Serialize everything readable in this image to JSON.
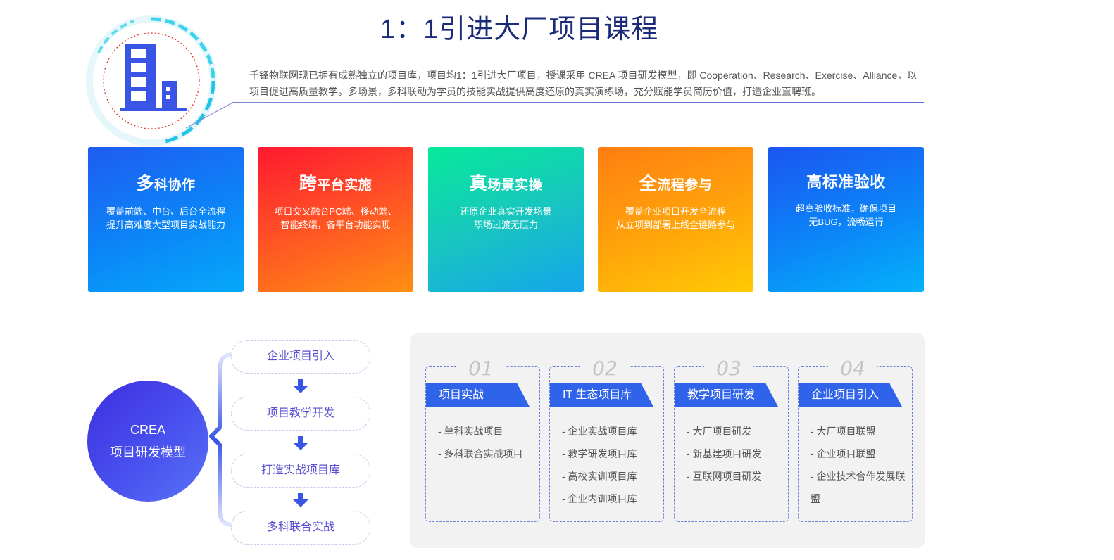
{
  "header": {
    "title": "1：1引进大厂项目课程",
    "intro": "千锋物联网现已拥有成熟独立的项目库，项目均1：1引进大厂项目，授课采用 CREA 项目研发模型，即 Cooperation、Research、Exercise、Alliance，以项目促进高质量教学。多场景，多科联动为学员的技能实战提供高度还原的真实演练场，充分赋能学员简历价值，打造企业直聘班。"
  },
  "cards": [
    {
      "lead": "多",
      "rest": "科协作",
      "desc1": "覆盖前端、中台、后台全流程",
      "desc2": "提升高难度大型项目实战能力"
    },
    {
      "lead": "跨",
      "rest": "平台实施",
      "desc1": "项目交叉融合PC端、移动端、",
      "desc2": "智能终端，各平台功能实现"
    },
    {
      "lead": "真",
      "rest": "场景实操",
      "desc1": "还原企业真实开发场景",
      "desc2": "职场过渡无压力"
    },
    {
      "lead": "全",
      "rest": "流程参与",
      "desc1": "覆盖企业项目开发全流程",
      "desc2": "从立项到部署上线全链路参与"
    },
    {
      "lead": "高",
      "rest": "标准验收",
      "desc1": "超高验收标准，确保项目",
      "desc2": "无BUG，流畅运行"
    }
  ],
  "crea": {
    "line1": "CREA",
    "line2": "项目研发模型",
    "steps": [
      "企业项目引入",
      "项目教学开发",
      "打造实战项目库",
      "多科联合实战"
    ]
  },
  "columns": [
    {
      "num": "01",
      "tag": "项目实战",
      "items": [
        "- 单科实战项目",
        "- 多科联合实战项目"
      ]
    },
    {
      "num": "02",
      "tag": "IT 生态项目库",
      "items": [
        "- 企业实战项目库",
        "- 教学研发项目库",
        "- 高校实训项目库",
        "- 企业内训项目库"
      ]
    },
    {
      "num": "03",
      "tag": "教学项目研发",
      "items": [
        "- 大厂项目研发",
        "- 新基建项目研发",
        "- 互联网项目研发"
      ]
    },
    {
      "num": "04",
      "tag": "企业项目引入",
      "items": [
        "- 大厂项目联盟",
        "- 企业项目联盟",
        "- 企业技术合作发展联盟"
      ]
    }
  ],
  "colors": {
    "title": "#1b2b78",
    "accent": "#2f63ea",
    "crea": "#4a54ef"
  }
}
